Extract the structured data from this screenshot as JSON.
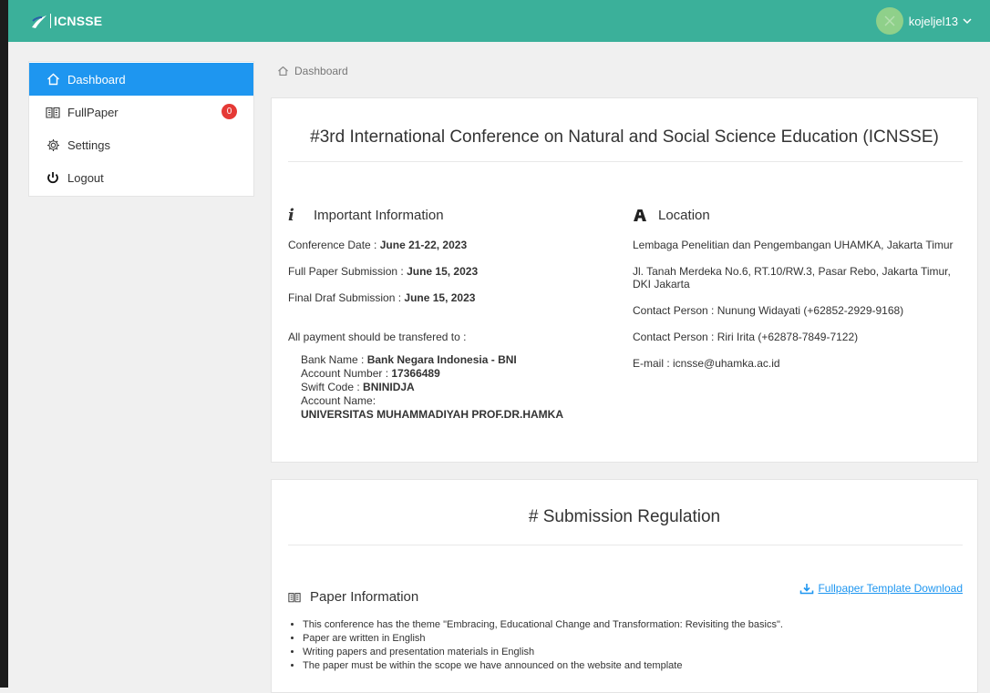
{
  "topbar": {
    "brand": "ICNSSE",
    "username": "kojeljel13",
    "color": "#3bb09a"
  },
  "sidebar": {
    "items": [
      {
        "label": "Dashboard",
        "icon": "home-icon",
        "active": true
      },
      {
        "label": "FullPaper",
        "icon": "book-icon",
        "badge": "0"
      },
      {
        "label": "Settings",
        "icon": "gear-icon"
      },
      {
        "label": "Logout",
        "icon": "power-icon"
      }
    ]
  },
  "breadcrumb": {
    "label": "Dashboard"
  },
  "conference": {
    "title": "#3rd International Conference on Natural and Social Science Education (ICNSSE)",
    "info": {
      "heading": "Important Information",
      "conference_date_label": "Conference Date : ",
      "conference_date": "June 21-22, 2023",
      "fullpaper_label": "Full Paper Submission : ",
      "fullpaper_date": "June 15, 2023",
      "finaldraf_label": "Final Draf Submission : ",
      "finaldraf_date": "June 15, 2023",
      "payment_note": "All payment should be transfered to :",
      "bank_name_label": "Bank Name : ",
      "bank_name": "Bank Negara Indonesia - BNI",
      "account_number_label": "Account Number : ",
      "account_number": "17366489",
      "swift_label": "Swift Code : ",
      "swift_code": "BNINIDJA",
      "account_name_label": "Account Name:",
      "account_name": "UNIVERSITAS MUHAMMADIYAH PROF.DR.HAMKA"
    },
    "location": {
      "heading": "Location",
      "line1": "Lembaga Penelitian dan Pengembangan UHAMKA, Jakarta Timur",
      "line2": "Jl. Tanah Merdeka No.6, RT.10/RW.3, Pasar Rebo, Jakarta Timur, DKI Jakarta",
      "contact1": "Contact Person : Nunung Widayati (+62852-2929-9168)",
      "contact2": "Contact Person : Riri Irita (+62878-7849-7122)",
      "email": "E-mail : icnsse@uhamka.ac.id"
    }
  },
  "regulation": {
    "title": "# Submission Regulation",
    "download_label": "Fullpaper Template Download",
    "paper_heading": "Paper Information",
    "bullets": [
      "This conference has the theme \"Embracing, Educational Change and Transformation: Revisiting the basics\".",
      "Paper are written in English",
      "Writing papers and presentation materials in English",
      "The paper must be within the scope we have announced on the website and template"
    ]
  }
}
